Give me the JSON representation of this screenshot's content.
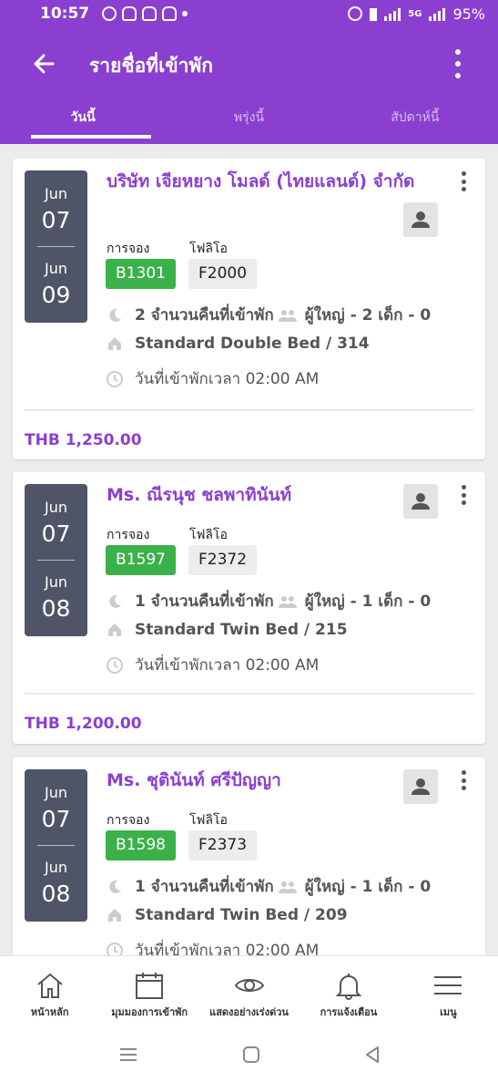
{
  "status_bar": {
    "time": "10:57",
    "battery": "95%",
    "network": "5G"
  },
  "header": {
    "title": "รายชื่อที่เข้าพัก",
    "tabs": [
      {
        "label": "วันนี้",
        "active": true
      },
      {
        "label": "พรุ่งนี้",
        "active": false
      },
      {
        "label": "สัปดาห์นี้",
        "active": false
      }
    ]
  },
  "labels": {
    "booking": "การจอง",
    "folio": "โฟลิโอ"
  },
  "reservations": [
    {
      "guest": "บริษัท เจียหยาง โมลด์ (ไทยแลนด์) จำกัด",
      "arrival_month": "Jun",
      "arrival_day": "07",
      "departure_month": "Jun",
      "departure_day": "09",
      "booking_no": "B1301",
      "folio_no": "F2000",
      "nights_text": "2 จำนวนคืนที่เข้าพัก",
      "guests_text": "ผู้ใหญ่ - 2 เด็ก - 0",
      "room": "Standard Double Bed / 314",
      "checkin": "วันที่เข้าพักเวลา 02:00 AM",
      "price": "THB 1,250.00"
    },
    {
      "guest": "Ms. ณีรนุช ชลพาทินันท์",
      "arrival_month": "Jun",
      "arrival_day": "07",
      "departure_month": "Jun",
      "departure_day": "08",
      "booking_no": "B1597",
      "folio_no": "F2372",
      "nights_text": "1 จำนวนคืนที่เข้าพัก",
      "guests_text": "ผู้ใหญ่ - 1 เด็ก - 0",
      "room": "Standard Twin Bed / 215",
      "checkin": "วันที่เข้าพักเวลา 02:00 AM",
      "price": "THB 1,200.00"
    },
    {
      "guest": "Ms. ชุตินันท์ ศรีปัญญา",
      "arrival_month": "Jun",
      "arrival_day": "07",
      "departure_month": "Jun",
      "departure_day": "08",
      "booking_no": "B1598",
      "folio_no": "F2373",
      "nights_text": "1 จำนวนคืนที่เข้าพัก",
      "guests_text": "ผู้ใหญ่ - 1 เด็ก - 0",
      "room": "Standard Twin Bed / 209",
      "checkin": "วันที่เข้าพักเวลา 02:00 AM"
    }
  ],
  "bottom_nav": [
    {
      "label": "หน้าหลัก",
      "icon": "home-icon"
    },
    {
      "label": "มุมมองการเข้าพัก",
      "icon": "calendar-icon"
    },
    {
      "label": "แสดงอย่างเร่งด่วน",
      "icon": "eye-icon"
    },
    {
      "label": "การแจ้งเตือน",
      "icon": "bell-icon"
    },
    {
      "label": "เมนู",
      "icon": "menu-icon"
    }
  ],
  "colors": {
    "primary": "#8b3fd1",
    "booking_chip": "#3bb14a",
    "date_box": "#4f5566"
  }
}
